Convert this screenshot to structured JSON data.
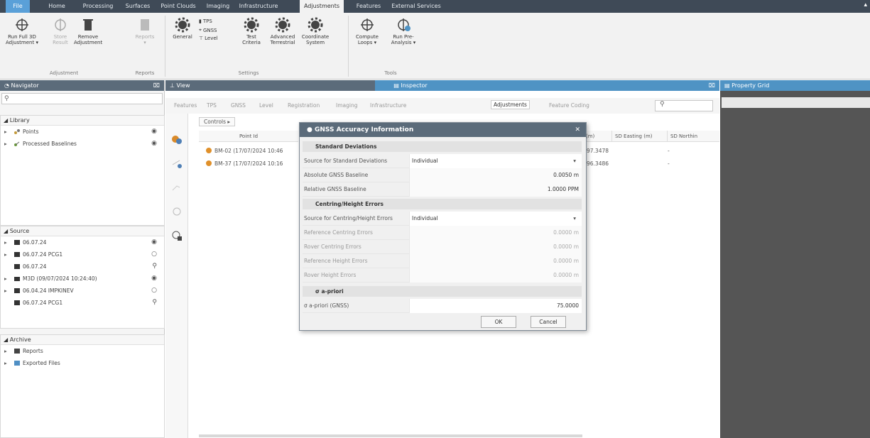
{
  "menu_tabs": [
    "File",
    "Home",
    "Processing",
    "Surfaces",
    "Point Clouds",
    "Imaging",
    "Infrastructure",
    "Adjustments",
    "Features",
    "External Services"
  ],
  "ribbon": {
    "adjustment_group": {
      "label": "Adjustment",
      "buttons": [
        "Run Full 3D Adjustment",
        "Store Result",
        "Remove Adjustment"
      ]
    },
    "reports_group": {
      "label": "Reports",
      "buttons": [
        "Reports"
      ]
    },
    "settings_group": {
      "label": "Settings",
      "general": "General",
      "small": [
        "TPS",
        "GNSS",
        "Level"
      ],
      "buttons": [
        "Test Criteria",
        "Advanced Terrestrial",
        "Coordinate System"
      ]
    },
    "tools_group": {
      "label": "Tools",
      "buttons": [
        "Compute Loops",
        "Run Pre-Analysis"
      ]
    }
  },
  "navigator": {
    "title": "Navigator",
    "search": "",
    "library": {
      "title": "Library",
      "items": [
        "Points",
        "Processed Baselines"
      ]
    },
    "source": {
      "title": "Source",
      "items": [
        "06.07.24",
        "06.07.24 PCG1",
        "06.07.24",
        "M3D (09/07/2024 10:24:40)",
        "06.04.24 IMPKINEV",
        "06.07.24 PCG1"
      ]
    },
    "archive": {
      "title": "Archive",
      "items": [
        "Reports",
        "Exported Files"
      ]
    }
  },
  "view": {
    "title": "View"
  },
  "inspector": {
    "title": "Inspector",
    "tabs": [
      "Features",
      "TPS",
      "GNSS",
      "Level",
      "Registration",
      "Imaging",
      "Infrastructure",
      "Adjustments",
      "Feature Coding"
    ],
    "active_tab": "Adjustments",
    "breadcrumb": "Controls",
    "columns": [
      "Point Id",
      "(m)",
      "SD Easting (m)",
      "SD Northin"
    ],
    "rows": [
      {
        "id": "BM-02 (17/07/2024 10:46",
        "val": "97.3478",
        "sd": "-"
      },
      {
        "id": "BM-37 (17/07/2024 10:16",
        "val": "96.3486",
        "sd": "-"
      }
    ]
  },
  "property_grid": {
    "title": "Property Grid"
  },
  "dialog": {
    "title": "GNSS Accuracy Information",
    "close": "✕",
    "sections": [
      {
        "title": "Standard Deviations",
        "rows": [
          {
            "label": "Source for Standard Deviations",
            "value": "Individual",
            "type": "select"
          },
          {
            "label": "Absolute GNSS Baseline",
            "value": "0.0050 m"
          },
          {
            "label": "Relative GNSS Baseline",
            "value": "1.0000 PPM"
          }
        ]
      },
      {
        "title": "Centring/Height Errors",
        "rows": [
          {
            "label": "Source for Centring/Height Errors",
            "value": "Individual",
            "type": "select"
          },
          {
            "label": "Reference Centring Errors",
            "value": "0.0000 m"
          },
          {
            "label": "Rover Centring Errors",
            "value": "0.0000 m"
          },
          {
            "label": "Reference Height Errors",
            "value": "0.0000 m"
          },
          {
            "label": "Rover Height Errors",
            "value": "0.0000 m"
          }
        ]
      },
      {
        "title": "σ a-priori",
        "rows": [
          {
            "label": "σ a-priori (GNSS)",
            "value": "75.0000"
          }
        ]
      }
    ],
    "ok": "OK",
    "cancel": "Cancel"
  }
}
